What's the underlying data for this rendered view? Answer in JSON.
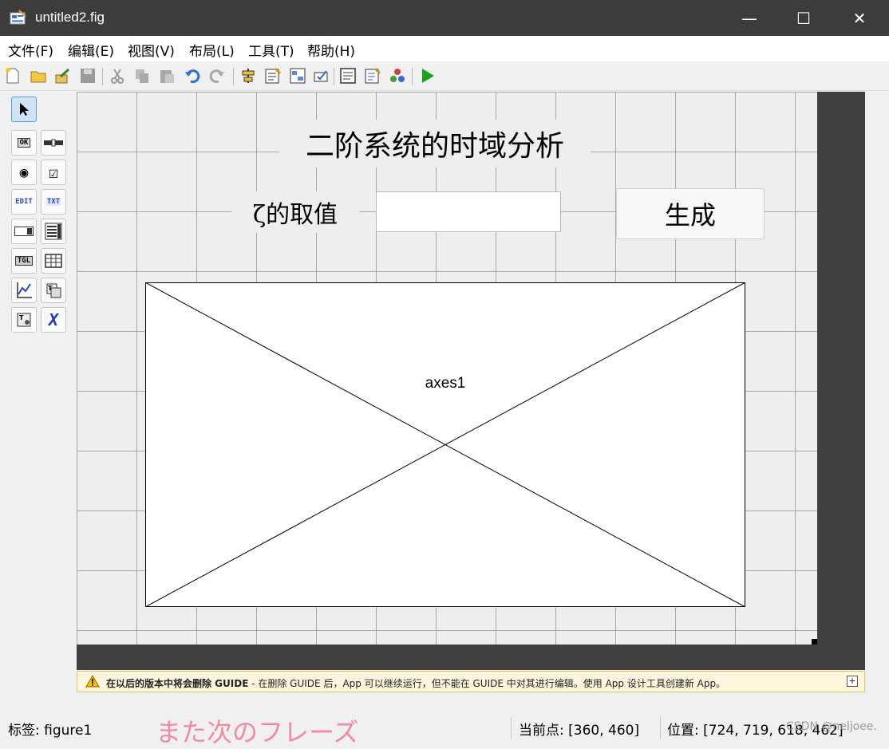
{
  "window": {
    "title": "untitled2.fig",
    "minimize": "—",
    "maximize": "☐",
    "close": "✕"
  },
  "menu": [
    "文件(F)",
    "编辑(E)",
    "视图(V)",
    "布局(L)",
    "工具(T)",
    "帮助(H)"
  ],
  "toolbar": {
    "icons": [
      "new-file-icon",
      "open-folder-icon",
      "export-icon",
      "save-icon",
      "cut-icon",
      "copy-icon",
      "paste-icon",
      "undo-icon",
      "redo-icon",
      "align-objects-icon",
      "menu-editor-icon",
      "tab-order-icon",
      "toolbar-editor-icon",
      "editor-icon",
      "property-inspector-icon",
      "object-browser-icon",
      "run-figure-icon"
    ]
  },
  "palette": {
    "items": [
      {
        "name": "select-tool",
        "label": "",
        "selected": true
      },
      {
        "name": "push-button-tool",
        "label": "OK"
      },
      {
        "name": "slider-tool",
        "label": ""
      },
      {
        "name": "radio-button-tool",
        "label": "◉"
      },
      {
        "name": "checkbox-tool",
        "label": "☑"
      },
      {
        "name": "edit-text-tool",
        "label": "EDIT"
      },
      {
        "name": "static-text-tool",
        "label": "TXT"
      },
      {
        "name": "popup-menu-tool",
        "label": ""
      },
      {
        "name": "listbox-tool",
        "label": ""
      },
      {
        "name": "toggle-button-tool",
        "label": "TGL"
      },
      {
        "name": "table-tool",
        "label": ""
      },
      {
        "name": "axes-tool",
        "label": ""
      },
      {
        "name": "panel-tool",
        "label": ""
      },
      {
        "name": "button-group-tool",
        "label": ""
      },
      {
        "name": "activex-tool",
        "label": "X"
      }
    ]
  },
  "figure": {
    "title_text": "二阶系统的时域分析",
    "zeta_label": "ζ的取值",
    "zeta_value": "",
    "generate_button": "生成",
    "axes_tag": "axes1"
  },
  "warning": {
    "bold": "在以后的版本中将会删除 GUIDE",
    "rest": " - 在删除 GUIDE 后，App 可以继续运行，但不能在 GUIDE 中对其进行编辑。使用 App 设计工具创建新 App。",
    "expand": "+"
  },
  "status": {
    "tag": "标签: figure1",
    "current_point": "当前点:  [360, 460]",
    "position": "位置: [724, 719, 618, 462]"
  },
  "watermarks": {
    "overlay": "また次のフレーズ",
    "csdn": "CSDN @neljoee."
  },
  "colors": {
    "titlebar": "#3c3c3c",
    "canvas": "#eeeeee",
    "warning_bg": "#fff6dd",
    "run_green": "#1aa31a"
  }
}
